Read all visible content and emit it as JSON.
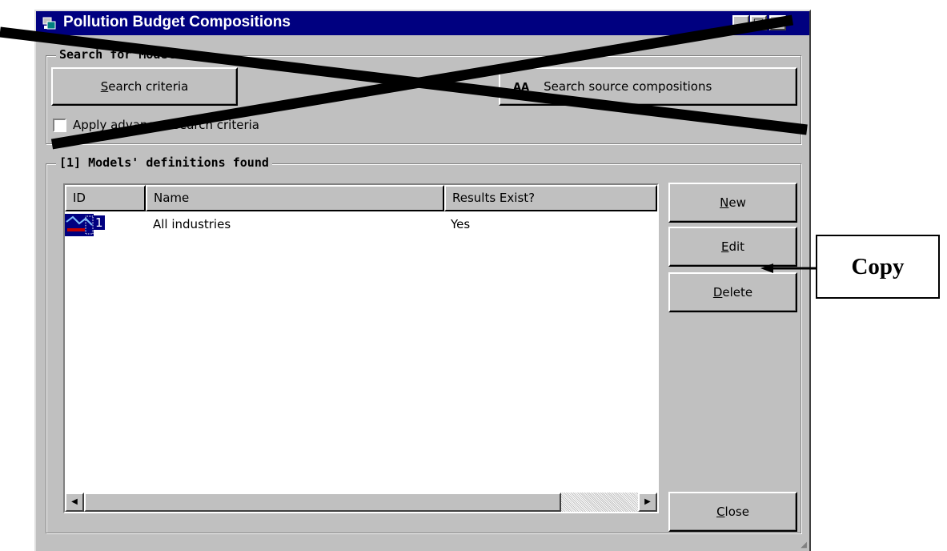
{
  "window": {
    "title": "Pollution Budget Compositions",
    "icon": "app-icon",
    "caption_buttons": {
      "minimize": "_",
      "maximize": "□",
      "close": "✕"
    }
  },
  "search_group": {
    "title": "Search for Models",
    "search_criteria_label": "Search criteria",
    "search_criteria_mnemonic": "S",
    "search_criteria_rest": "earch criteria",
    "search_source_icon": "AA",
    "search_source_label": "Search source compositions",
    "advanced_checkbox_label": "Apply advanced search criteria",
    "advanced_checked": false
  },
  "models_group": {
    "title": "[1] Models' definitions found",
    "columns": [
      "ID",
      "Name",
      "Results Exist?"
    ],
    "rows": [
      {
        "id": "1",
        "name": "All industries",
        "results_exist": "Yes",
        "selected": true
      }
    ]
  },
  "buttons": {
    "new": {
      "mnemonic": "N",
      "rest": "ew"
    },
    "edit": {
      "mnemonic": "E",
      "rest": "dit"
    },
    "delete": {
      "mnemonic": "D",
      "rest": "elete"
    },
    "close": {
      "mnemonic": "C",
      "rest": "lose"
    }
  },
  "annotation": {
    "copy_label": "Copy"
  }
}
